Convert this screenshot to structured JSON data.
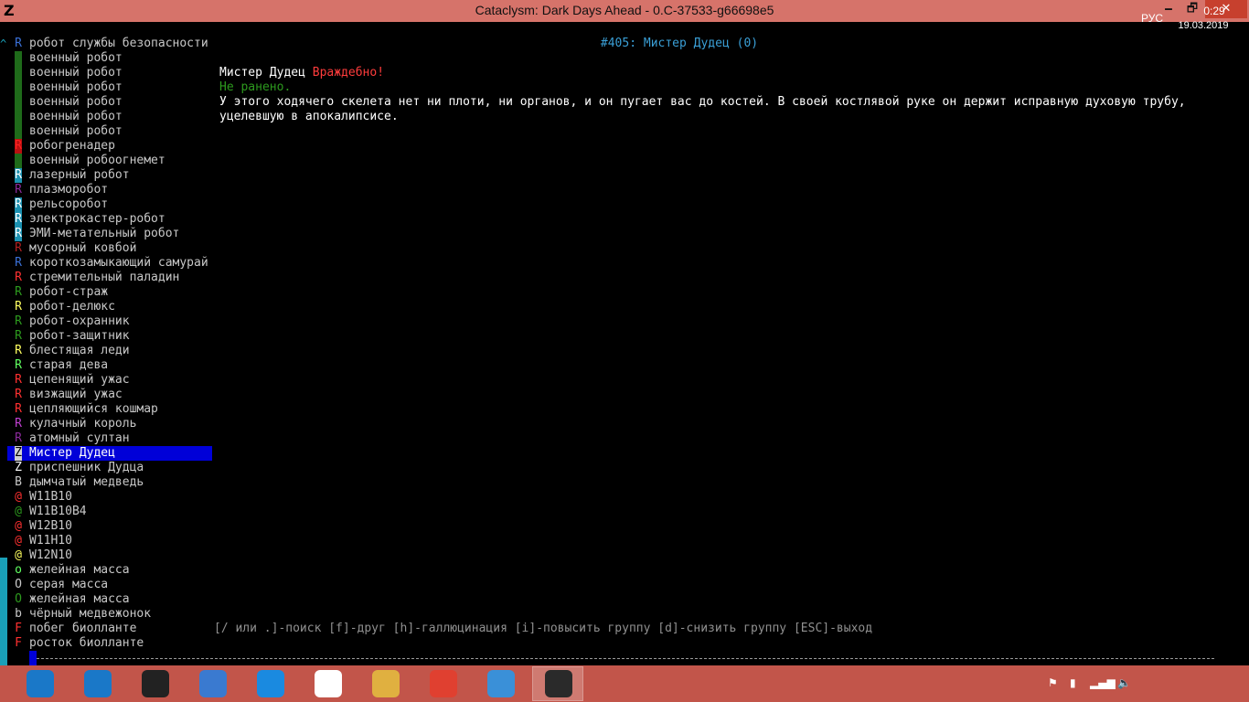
{
  "window": {
    "app_icon": "Z",
    "title": "Cataclysm: Dark Days Ahead - 0.C-37533-g66698e5",
    "minimize_glyph": "🗕",
    "maximize_glyph": "🗗",
    "close_glyph": "✕"
  },
  "monsters": [
    {
      "sym": "R",
      "name": "робот службы безопасности",
      "fg": "#3a70d6",
      "bg": ""
    },
    {
      "sym": "R",
      "name": "военный робот",
      "fg": "#1f6b1a",
      "bg": "#1f6b1a"
    },
    {
      "sym": "R",
      "name": "военный робот",
      "fg": "#1f6b1a",
      "bg": "#1f6b1a"
    },
    {
      "sym": "R",
      "name": "военный робот",
      "fg": "#1f6b1a",
      "bg": "#1f6b1a"
    },
    {
      "sym": "R",
      "name": "военный робот",
      "fg": "#1f6b1a",
      "bg": "#1f6b1a"
    },
    {
      "sym": "R",
      "name": "военный робот",
      "fg": "#1f6b1a",
      "bg": "#1f6b1a"
    },
    {
      "sym": "R",
      "name": "военный робот",
      "fg": "#1f6b1a",
      "bg": "#1f6b1a"
    },
    {
      "sym": "R",
      "name": "робогренадер",
      "fg": "#ff2020",
      "bg": "#b81010"
    },
    {
      "sym": "R",
      "name": "военный робоогнемет",
      "fg": "#1f6b1a",
      "bg": "#1f6b1a"
    },
    {
      "sym": "R",
      "name": "лазерный робот",
      "fg": "#ffffff",
      "bg": "#1a90b0"
    },
    {
      "sym": "R",
      "name": "плазморобот",
      "fg": "#8a2a9a",
      "bg": ""
    },
    {
      "sym": "R",
      "name": "рельсоробот",
      "fg": "#ffffff",
      "bg": "#1a90b0"
    },
    {
      "sym": "R",
      "name": "электрокастер-робот",
      "fg": "#ffffff",
      "bg": "#1a90b0"
    },
    {
      "sym": "R",
      "name": "ЭМИ-метательный робот",
      "fg": "#ffffff",
      "bg": "#1a90b0"
    },
    {
      "sym": "R",
      "name": "мусорный ковбой",
      "fg": "#b02020",
      "bg": ""
    },
    {
      "sym": "R",
      "name": "короткозамыкающий самурай",
      "fg": "#3a70d6",
      "bg": ""
    },
    {
      "sym": "R",
      "name": "стремительный паладин",
      "fg": "#ff3030",
      "bg": ""
    },
    {
      "sym": "R",
      "name": "робот-страж",
      "fg": "#2d9a1e",
      "bg": ""
    },
    {
      "sym": "R",
      "name": "робот-делюкс",
      "fg": "#ffff60",
      "bg": ""
    },
    {
      "sym": "R",
      "name": "робот-охранник",
      "fg": "#2d9a1e",
      "bg": ""
    },
    {
      "sym": "R",
      "name": "робот-защитник",
      "fg": "#2d9a1e",
      "bg": ""
    },
    {
      "sym": "R",
      "name": "блестящая леди",
      "fg": "#ffff60",
      "bg": ""
    },
    {
      "sym": "R",
      "name": "старая дева",
      "fg": "#60ff60",
      "bg": ""
    },
    {
      "sym": "R",
      "name": "цепенящий ужас",
      "fg": "#ff3030",
      "bg": ""
    },
    {
      "sym": "R",
      "name": "визжащий ужас",
      "fg": "#ff3030",
      "bg": ""
    },
    {
      "sym": "R",
      "name": "цепляющийся кошмар",
      "fg": "#ff3030",
      "bg": ""
    },
    {
      "sym": "R",
      "name": "кулачный король",
      "fg": "#c040d0",
      "bg": ""
    },
    {
      "sym": "R",
      "name": "атомный султан",
      "fg": "#8a2a9a",
      "bg": ""
    },
    {
      "sym": "Z",
      "name": "Мистер Дудец",
      "fg": "#000000",
      "bg": "#d0d0d0",
      "selected": true
    },
    {
      "sym": "Z",
      "name": "приспешник Дудца",
      "fg": "#ffffff",
      "bg": ""
    },
    {
      "sym": "B",
      "name": "дымчатый медведь",
      "fg": "#c8c8c8",
      "bg": ""
    },
    {
      "sym": "@",
      "name": "W11B10",
      "fg": "#ff3030",
      "bg": ""
    },
    {
      "sym": "@",
      "name": "W11B10B4",
      "fg": "#2d9a1e",
      "bg": ""
    },
    {
      "sym": "@",
      "name": "W12B10",
      "fg": "#ff3030",
      "bg": ""
    },
    {
      "sym": "@",
      "name": "W11H10",
      "fg": "#ff3030",
      "bg": ""
    },
    {
      "sym": "@",
      "name": "W12N10",
      "fg": "#ffff60",
      "bg": ""
    },
    {
      "sym": "o",
      "name": "желейная масса",
      "fg": "#60ff60",
      "bg": ""
    },
    {
      "sym": "O",
      "name": "серая масса",
      "fg": "#c8c8c8",
      "bg": ""
    },
    {
      "sym": "O",
      "name": "желейная масса",
      "fg": "#2d9a1e",
      "bg": ""
    },
    {
      "sym": "b",
      "name": "чёрный медвежонок",
      "fg": "#c8c8c8",
      "bg": ""
    },
    {
      "sym": "F",
      "name": "побег биолланте",
      "fg": "#ff3030",
      "bg": ""
    },
    {
      "sym": "F",
      "name": "росток биолланте",
      "fg": "#ff3030",
      "bg": ""
    }
  ],
  "scroll": {
    "up": "^",
    "down": "v"
  },
  "info": {
    "header": "#405: Мистер Дудец (0)",
    "name": "Мистер Дудец",
    "attitude": "Враждебно!",
    "health": "Не ранено.",
    "description": "У этого ходячего скелета нет ни плоти, ни органов, и он пугает вас до костей. В своей костлявой руке он держит исправную духовую трубу, уцелевшую в апокалипсисе.",
    "help": "[/ или .]-поиск [f]-друг [h]-галлюцинация [i]-повысить группу [d]-снизить группу [ESC]-выход"
  },
  "taskbar": {
    "apps": [
      {
        "icon": "jet-icon",
        "color": "#1a78c8"
      },
      {
        "icon": "rocket-icon",
        "color": "#1a78c8"
      },
      {
        "icon": "webcam-icon",
        "color": "#222222"
      },
      {
        "icon": "calculator-icon",
        "color": "#3a7ad0"
      },
      {
        "icon": "lightning-icon",
        "color": "#1a8ae0"
      },
      {
        "icon": "hp-icon",
        "color": "#ffffff"
      },
      {
        "icon": "folder-icon",
        "color": "#e0b040"
      },
      {
        "icon": "chrome-icon",
        "color": "#e04030"
      },
      {
        "icon": "media-player-icon",
        "color": "#3a90d8"
      },
      {
        "icon": "cataclysm-icon",
        "color": "#2a2a2a",
        "active": true
      }
    ],
    "tray_lang": "РУС",
    "time": "0:29",
    "date": "19.03.2019"
  }
}
